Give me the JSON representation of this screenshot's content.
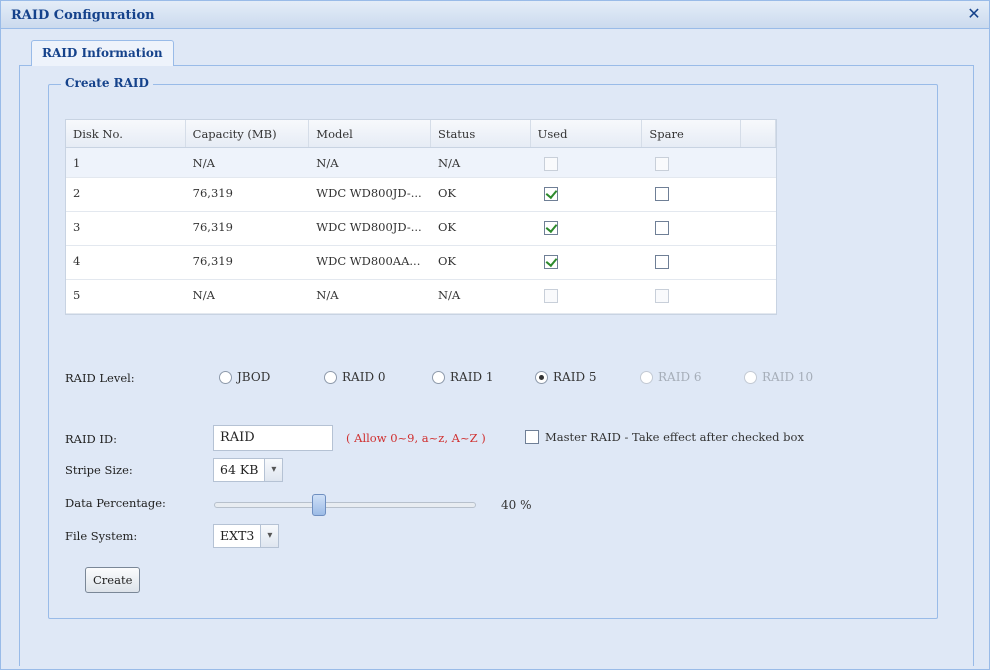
{
  "window": {
    "title": "RAID Configuration",
    "close_label": "✕"
  },
  "tabs": [
    {
      "label": "RAID Information"
    }
  ],
  "create_raid": {
    "legend": "Create RAID",
    "columns": [
      "Disk No.",
      "Capacity (MB)",
      "Model",
      "Status",
      "Used",
      "Spare"
    ],
    "disks": [
      {
        "no": "1",
        "capacity": "N/A",
        "model": "N/A",
        "status": "N/A",
        "used": false,
        "spare": false,
        "enabled": false
      },
      {
        "no": "2",
        "capacity": "76,319",
        "model": "WDC WD800JD-...",
        "status": "OK",
        "used": true,
        "spare": false,
        "enabled": true
      },
      {
        "no": "3",
        "capacity": "76,319",
        "model": "WDC WD800JD-...",
        "status": "OK",
        "used": true,
        "spare": false,
        "enabled": true
      },
      {
        "no": "4",
        "capacity": "76,319",
        "model": "WDC WD800AA...",
        "status": "OK",
        "used": true,
        "spare": false,
        "enabled": true
      },
      {
        "no": "5",
        "capacity": "N/A",
        "model": "N/A",
        "status": "N/A",
        "used": false,
        "spare": false,
        "enabled": false
      }
    ],
    "raid_level": {
      "label": "RAID Level:",
      "options": [
        {
          "label": "JBOD",
          "selected": false,
          "enabled": true
        },
        {
          "label": "RAID 0",
          "selected": false,
          "enabled": true
        },
        {
          "label": "RAID 1",
          "selected": false,
          "enabled": true
        },
        {
          "label": "RAID 5",
          "selected": true,
          "enabled": true
        },
        {
          "label": "RAID 6",
          "selected": false,
          "enabled": false
        },
        {
          "label": "RAID 10",
          "selected": false,
          "enabled": false
        }
      ]
    },
    "raid_id": {
      "label": "RAID ID:",
      "value": "RAID",
      "hint": "( Allow 0~9, a~z, A~Z )"
    },
    "master_raid": {
      "label": "Master RAID - Take effect after checked box",
      "checked": false
    },
    "stripe_size": {
      "label": "Stripe Size:",
      "value": "64 KB"
    },
    "data_percentage": {
      "label": "Data Percentage:",
      "value_text": "40 %",
      "value": 40
    },
    "file_system": {
      "label": "File System:",
      "value": "EXT3"
    },
    "create_button": "Create"
  }
}
